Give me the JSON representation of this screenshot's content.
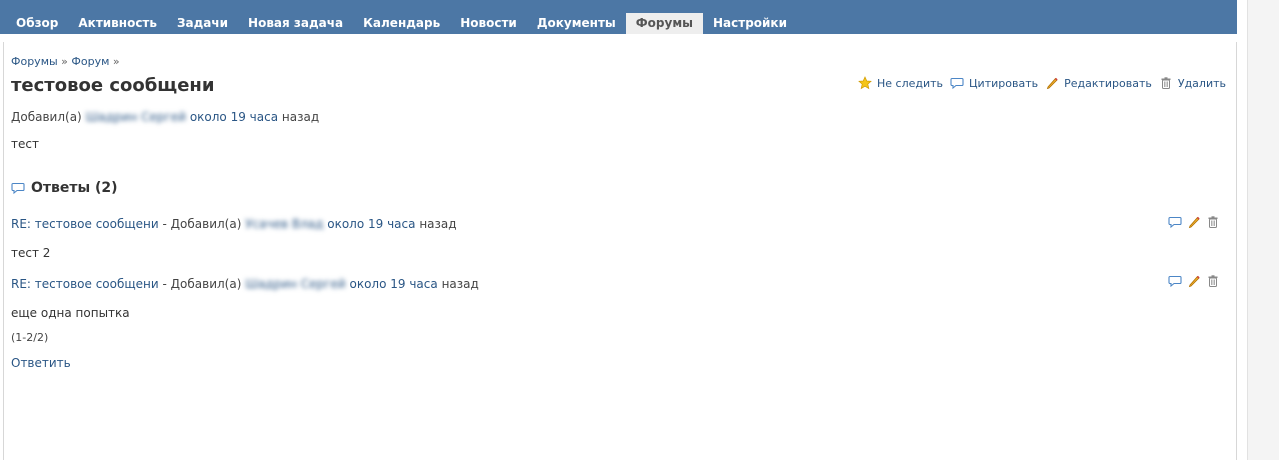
{
  "nav": {
    "tabs": [
      {
        "label": "Обзор"
      },
      {
        "label": "Активность"
      },
      {
        "label": "Задачи"
      },
      {
        "label": "Новая задача"
      },
      {
        "label": "Календарь"
      },
      {
        "label": "Новости"
      },
      {
        "label": "Документы"
      },
      {
        "label": "Форумы"
      },
      {
        "label": "Настройки"
      }
    ],
    "selected": "Форумы"
  },
  "breadcrumb": {
    "item1": "Форумы",
    "sep1": " » ",
    "item2": "Форум",
    "sep2": " »"
  },
  "topic": {
    "title": "тестовое сообщени",
    "added_by": "Добавил(а)",
    "author": "Шадрин Сергей",
    "time": "около 19 часа",
    "ago": "назад",
    "body": "тест"
  },
  "actions": {
    "watch": "Не следить",
    "quote": "Цитировать",
    "edit": "Редактировать",
    "delete": "Удалить"
  },
  "answers": {
    "heading": "Ответы (2)",
    "items": [
      {
        "subject": "RE: тестовое сообщени",
        "dash": " - ",
        "added_by": "Добавил(а)",
        "author": "Усачев Влад",
        "time": "около 19 часа",
        "ago": "назад",
        "body": "тест 2"
      },
      {
        "subject": "RE: тестовое сообщени",
        "dash": " - ",
        "added_by": "Добавил(а)",
        "author": "Шадрин Сергей",
        "time": "около 19 часа",
        "ago": "назад",
        "body": "еще одна попытка"
      }
    ]
  },
  "pager": "(1-2/2)",
  "reply_link": "Ответить",
  "colors": {
    "header": "#4c77a5",
    "link": "#2a5685"
  }
}
